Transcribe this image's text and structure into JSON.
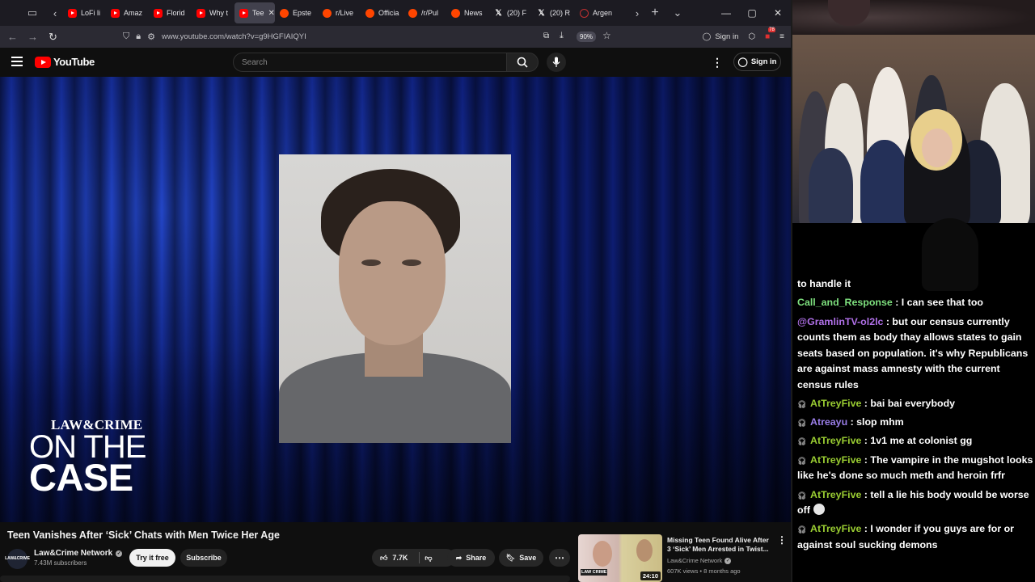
{
  "browser": {
    "tabs": [
      {
        "label": "LoFi li",
        "favicon": "youtube"
      },
      {
        "label": "Amaz",
        "favicon": "youtube"
      },
      {
        "label": "Florid",
        "favicon": "youtube"
      },
      {
        "label": "Why t",
        "favicon": "youtube"
      },
      {
        "label": "Tee",
        "favicon": "youtube",
        "active": true
      },
      {
        "label": "Epste",
        "favicon": "reddit"
      },
      {
        "label": "r/Live",
        "favicon": "reddit"
      },
      {
        "label": "Officia",
        "favicon": "reddit"
      },
      {
        "label": "/r/Pul",
        "favicon": "reddit"
      },
      {
        "label": "News",
        "favicon": "reddit"
      },
      {
        "label": "(20) F",
        "favicon": "x"
      },
      {
        "label": "(20) R",
        "favicon": "x"
      },
      {
        "label": "Argen",
        "favicon": "argentina"
      }
    ],
    "url": "www.youtube.com/watch?v=g9HGFIAIQYI",
    "zoom": "90%",
    "signin_label": "Sign in",
    "extension_badge": "78"
  },
  "youtube": {
    "logo_text": "YouTube",
    "search_placeholder": "Search",
    "signin_label": "Sign in"
  },
  "video": {
    "brand_top": "LAW&CRIME",
    "brand_line": "ON THE",
    "brand_case": "CASE",
    "title": "Teen Vanishes After ‘Sick’ Chats with Men Twice Her Age",
    "channel": "Law&Crime Network",
    "avatar_text": "LAW&CRIME",
    "subscribers": "7.43M subscribers",
    "try_label": "Try it free",
    "subscribe_label": "Subscribe",
    "likes": "7.7K",
    "share_label": "Share",
    "save_label": "Save"
  },
  "recommendation": {
    "title": "Missing Teen Found Alive After 3 ‘Sick’ Men Arrested in Twist...",
    "channel": "Law&Crime Network",
    "meta": "607K views • 8 months ago",
    "duration": "24:10",
    "thumb_tag": "LAW CRIME"
  },
  "chat": {
    "messages": [
      {
        "user": "",
        "text": "to handle it",
        "color": "#ffffff"
      },
      {
        "user": "Call_and_Response",
        "text": " : I can see that too",
        "color": "#7ee07e"
      },
      {
        "user": "@GramlinTV-ol2lc",
        "text": " : but our census currently counts them as body thay allows states to gain seats based on population. it's why Republicans are against mass amnesty with the current census rules",
        "color": "#b070e8"
      },
      {
        "user": "AtTreyFive",
        "text": " : bai bai everybody",
        "color": "#9acd32",
        "badge": true
      },
      {
        "user": "Atreayu",
        "text": " : slop mhm",
        "color": "#9a7ee8",
        "badge": true
      },
      {
        "user": "AtTreyFive",
        "text": " : 1v1 me at colonist gg",
        "color": "#9acd32",
        "badge": true
      },
      {
        "user": "AtTreyFive",
        "text": " : The vampire in the mugshot looks like he's done so much meth and heroin frfr",
        "color": "#9acd32",
        "badge": true
      },
      {
        "user": "AtTreyFive",
        "text": " : tell a lie his body would be worse off",
        "color": "#9acd32",
        "badge": true,
        "emote": true
      },
      {
        "user": "AtTreyFive",
        "text": " : I wonder if you guys are for or against soul sucking demons",
        "color": "#9acd32",
        "badge": true
      }
    ]
  },
  "colors": {
    "youtube_red": "#ff0000",
    "chat_green": "#7ee07e",
    "chat_purple": "#b070e8"
  }
}
